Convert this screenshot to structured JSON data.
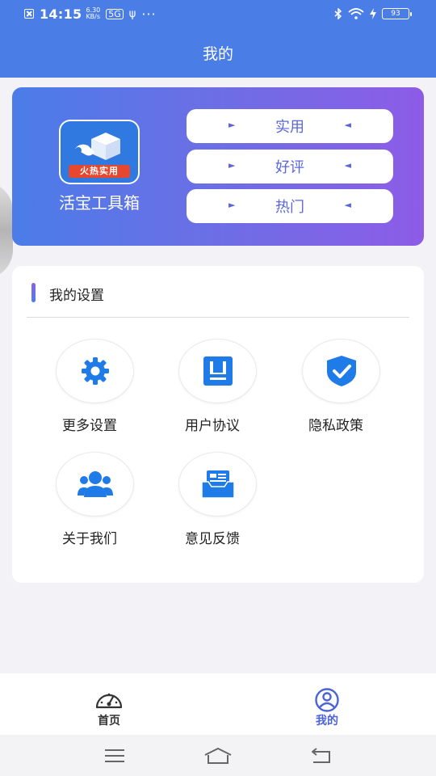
{
  "status_bar": {
    "time": "14:15",
    "speed_value": "6.30",
    "speed_unit": "KB/s",
    "badge": "5G",
    "battery": "93"
  },
  "header": {
    "title": "我的"
  },
  "banner": {
    "app_name": "活宝工具箱",
    "logo_tag": "火热实用",
    "pills": [
      {
        "label": "实用"
      },
      {
        "label": "好评"
      },
      {
        "label": "热门"
      }
    ],
    "arrow_left": "►",
    "arrow_right": "◄"
  },
  "settings": {
    "title": "我的设置",
    "items": [
      {
        "label": "更多设置",
        "icon": "gear-icon"
      },
      {
        "label": "用户协议",
        "icon": "document-icon"
      },
      {
        "label": "隐私政策",
        "icon": "shield-check-icon"
      },
      {
        "label": "关于我们",
        "icon": "users-icon"
      },
      {
        "label": "意见反馈",
        "icon": "inbox-icon"
      }
    ]
  },
  "tabbar": {
    "tabs": [
      {
        "label": "首页",
        "icon": "dashboard-icon",
        "active": false
      },
      {
        "label": "我的",
        "icon": "user-circle-icon",
        "active": true
      }
    ]
  },
  "colors": {
    "primary": "#4a7de6",
    "icon_blue": "#1e7be8",
    "active_tab": "#4a63d6",
    "inactive_tab": "#333333",
    "banner_start": "#4b7ce8",
    "banner_end": "#8d5ce6"
  }
}
